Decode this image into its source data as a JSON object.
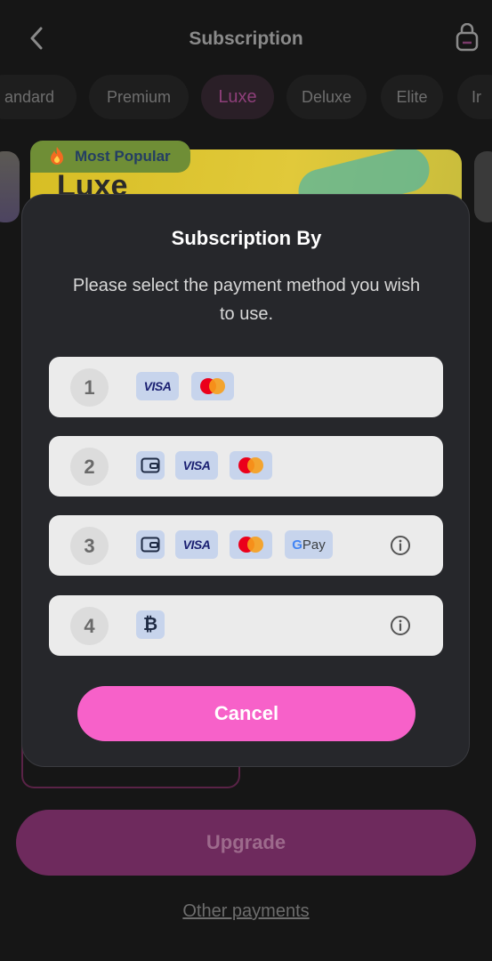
{
  "header": {
    "title": "Subscription",
    "back_icon": "chevron-left-icon",
    "bag_icon": "shopping-bag-icon"
  },
  "tabs": [
    {
      "label": "andard"
    },
    {
      "label": "Premium"
    },
    {
      "label": "Luxe",
      "active": true
    },
    {
      "label": "Deluxe"
    },
    {
      "label": "Elite"
    },
    {
      "label": "Ir"
    }
  ],
  "plan_card": {
    "badge": "Most Popular",
    "badge_icon": "fire-icon",
    "name": "Luxe"
  },
  "modal": {
    "title": "Subscription By",
    "subtitle": "Please select the payment method you wish to use.",
    "options": [
      {
        "number": "1",
        "methods": [
          "VISA",
          "mastercard"
        ]
      },
      {
        "number": "2",
        "methods": [
          "wallet",
          "VISA",
          "mastercard"
        ]
      },
      {
        "number": "3",
        "methods": [
          "wallet",
          "VISA",
          "mastercard",
          "GPay"
        ],
        "info": true
      },
      {
        "number": "4",
        "methods": [
          "bitcoin"
        ],
        "info": true
      }
    ],
    "visa_label": "VISA",
    "gpay_g": "G",
    "gpay_label": "Pay",
    "bitcoin_symbol": "₿",
    "cancel_label": "Cancel"
  },
  "footer": {
    "upgrade_label": "Upgrade",
    "other_payments_label": "Other payments"
  },
  "colors": {
    "accent": "#f761c9",
    "modal_bg": "#26272b",
    "option_bg": "#ebebeb",
    "chip_bg": "#c7d4ec"
  }
}
